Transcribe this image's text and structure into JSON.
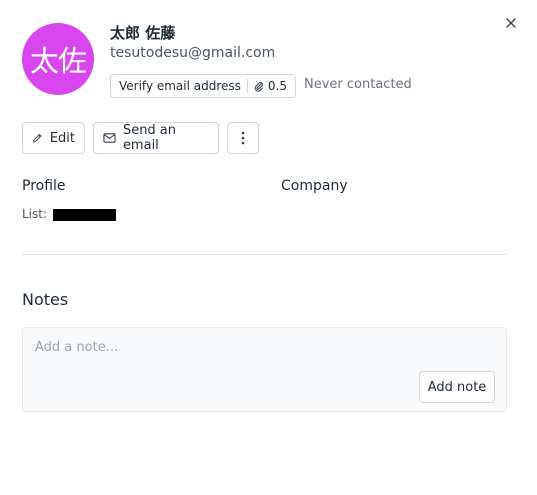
{
  "contact": {
    "avatar_initials": "太佐",
    "avatar_color": "#d946ef",
    "name": "太郎 佐藤",
    "email": "tesutodesu@gmail.com"
  },
  "verify": {
    "label": "Verify email address",
    "credits": "0.5",
    "credits_icon": "paperclip-icon"
  },
  "status": {
    "contacted": "Never contacted"
  },
  "actions": {
    "edit_label": "Edit",
    "edit_icon": "pencil-icon",
    "send_label": "Send an email",
    "send_icon": "envelope-icon",
    "more_icon": "vertical-dots-icon"
  },
  "profile": {
    "label": "Profile",
    "list_label": "List:",
    "list_value_redacted": true
  },
  "company": {
    "label": "Company"
  },
  "notes": {
    "title": "Notes",
    "placeholder": "Add a note...",
    "add_label": "Add note"
  },
  "icons": {
    "close": "close-icon"
  }
}
